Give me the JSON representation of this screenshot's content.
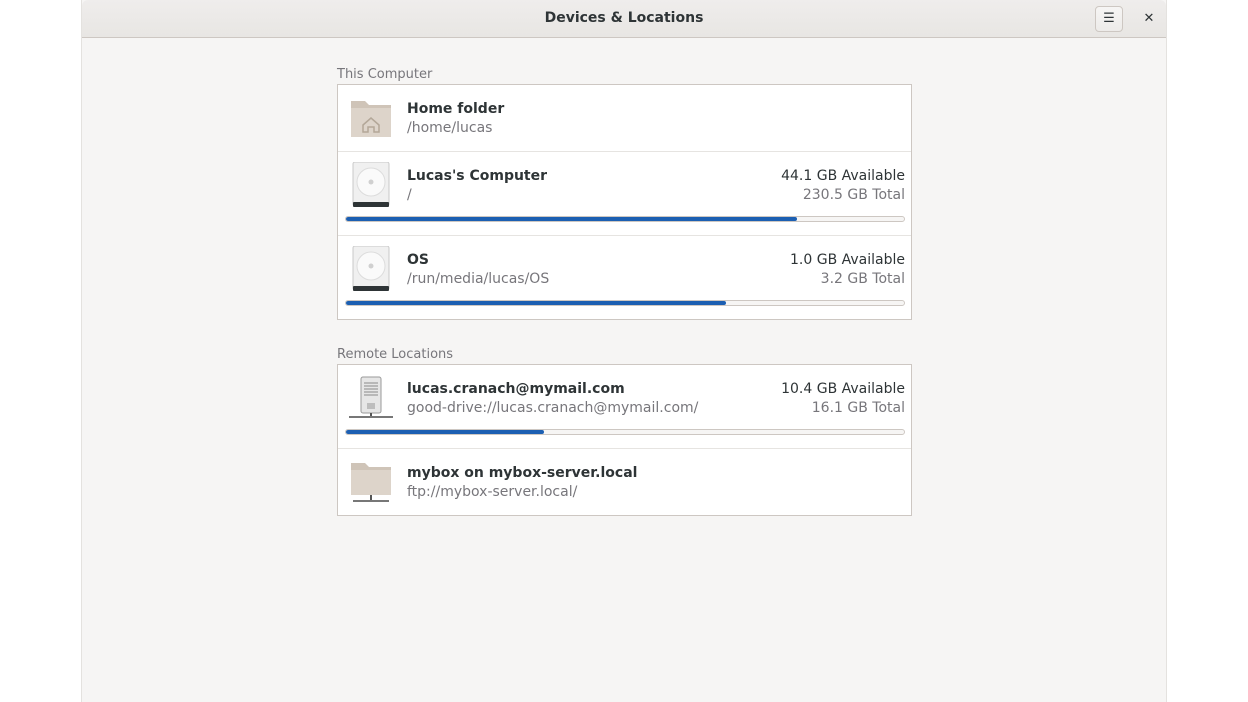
{
  "window": {
    "title": "Devices & Locations",
    "menu_icon": "hamburger-menu-icon",
    "menu_glyph": "☰",
    "close_icon": "close-icon",
    "close_glyph": "✕"
  },
  "this_computer": {
    "heading": "This Computer",
    "items": [
      {
        "name": "Home folder",
        "path": "/home/lucas",
        "icon": "home-folder-icon"
      },
      {
        "name": "Lucas's Computer",
        "path": "/",
        "available": "44.1 GB Available",
        "total": "230.5 GB Total",
        "used_fraction": 0.809,
        "icon": "hard-drive-icon"
      },
      {
        "name": "OS",
        "path": "/run/media/lucas/OS",
        "available": "1.0 GB Available",
        "total": "3.2 GB Total",
        "used_fraction": 0.681,
        "icon": "hard-drive-icon"
      }
    ]
  },
  "remote_locations": {
    "heading": "Remote Locations",
    "items": [
      {
        "name": "lucas.cranach@mymail.com",
        "path": "good-drive://lucas.cranach@mymail.com/",
        "available": "10.4 GB Available",
        "total": "16.1 GB Total",
        "used_fraction": 0.354,
        "icon": "network-server-icon"
      },
      {
        "name": "mybox on mybox-server.local",
        "path": "ftp://mybox-server.local/",
        "icon": "network-folder-icon"
      }
    ]
  },
  "colors": {
    "accent": "#1c5fb2",
    "window_bg": "#f6f5f4",
    "folder": "#d9cfc5"
  }
}
